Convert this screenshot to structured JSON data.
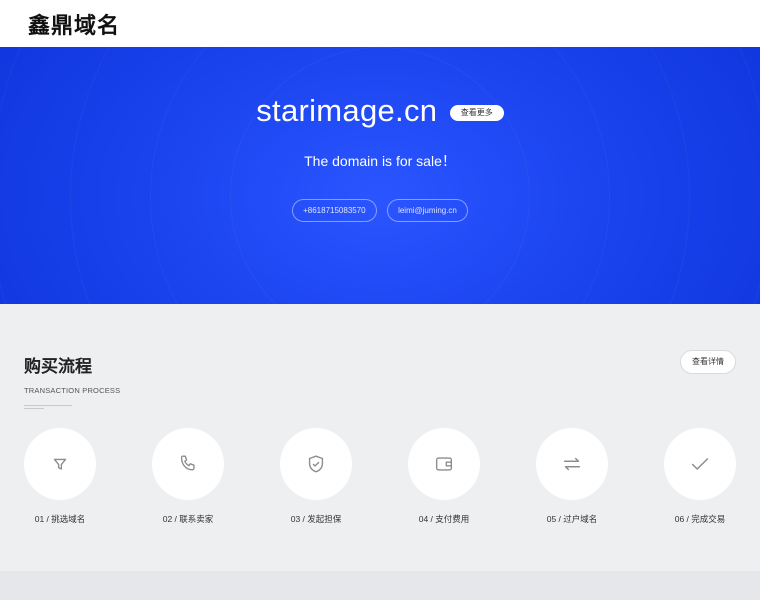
{
  "header": {
    "logo": "鑫鼎域名"
  },
  "hero": {
    "domain": "starimage.cn",
    "more_label": "查看更多",
    "sale_text": "The domain is for sale！",
    "phone": "+8618715083570",
    "email": "leimi@juming.cn"
  },
  "process": {
    "title": "购买流程",
    "subtitle": "TRANSACTION PROCESS",
    "detail_label": "查看详情",
    "steps": [
      {
        "label": "01 / 挑选域名",
        "icon": "filter-icon"
      },
      {
        "label": "02 / 联系卖家",
        "icon": "phone-icon"
      },
      {
        "label": "03 / 发起担保",
        "icon": "shield-check-icon"
      },
      {
        "label": "04 / 支付费用",
        "icon": "wallet-icon"
      },
      {
        "label": "05 / 过户域名",
        "icon": "transfer-arrows-icon"
      },
      {
        "label": "06 / 完成交易",
        "icon": "checkmark-icon"
      }
    ]
  },
  "colors": {
    "hero_blue": "#1a43ee",
    "icon_gray": "#8a8c90"
  }
}
